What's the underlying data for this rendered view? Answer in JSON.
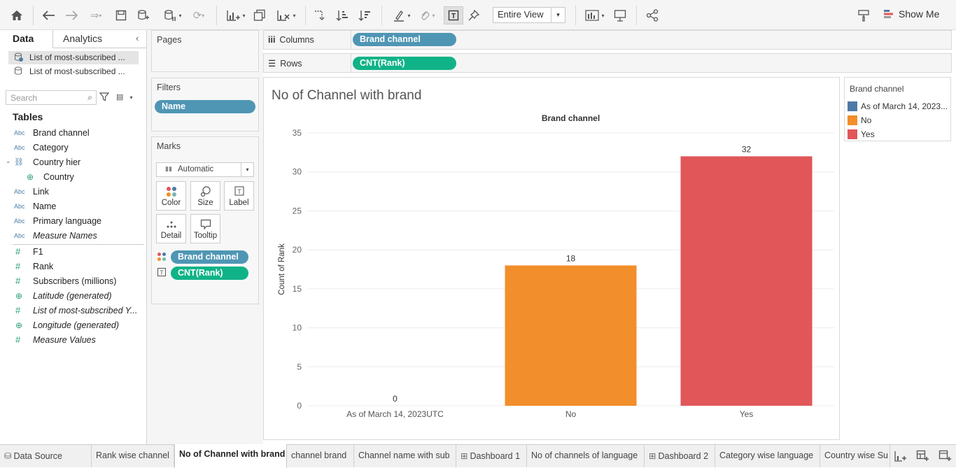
{
  "toolbar": {
    "view_select": "Entire View",
    "show_me": "Show Me"
  },
  "left": {
    "tab_data": "Data",
    "tab_analytics": "Analytics",
    "datasources": [
      "List of most-subscribed ...",
      "List of most-subscribed ..."
    ],
    "search_placeholder": "Search",
    "tables_label": "Tables",
    "dimensions": [
      "Brand channel",
      "Category",
      "Country hier",
      "Country",
      "Link",
      "Name",
      "Primary language",
      "Measure Names"
    ],
    "measures": [
      "F1",
      "Rank",
      "Subscribers (millions)",
      "Latitude (generated)",
      "List of most-subscribed Y...",
      "Longitude (generated)",
      "Measure Values"
    ]
  },
  "cards": {
    "pages": "Pages",
    "filters": "Filters",
    "filter_pill": "Name",
    "marks": "Marks",
    "marks_type": "Automatic",
    "btn_color": "Color",
    "btn_size": "Size",
    "btn_label": "Label",
    "btn_detail": "Detail",
    "btn_tooltip": "Tooltip",
    "marks_pill_color": "Brand channel",
    "marks_pill_label": "CNT(Rank)"
  },
  "shelves": {
    "columns_label": "Columns",
    "columns_pill": "Brand channel",
    "rows_label": "Rows",
    "rows_pill": "CNT(Rank)"
  },
  "viz": {
    "title": "No of Channel with brand"
  },
  "legend": {
    "title": "Brand channel",
    "items": [
      {
        "label": "As of March 14, 2023...",
        "color": "#4e79a7"
      },
      {
        "label": "No",
        "color": "#f28e2b"
      },
      {
        "label": "Yes",
        "color": "#e15759"
      }
    ]
  },
  "chart_data": {
    "type": "bar",
    "title": "Brand channel",
    "categories": [
      "As of March 14, 2023UTC",
      "No",
      "Yes"
    ],
    "values": [
      0,
      18,
      32
    ],
    "data_labels": [
      "0",
      "18",
      "32"
    ],
    "colors": [
      "#4e79a7",
      "#f28e2b",
      "#e15759"
    ],
    "xlabel": "",
    "ylabel": "Count of Rank",
    "ylim": [
      0,
      35
    ],
    "yticks": [
      0,
      5,
      10,
      15,
      20,
      25,
      30,
      35
    ],
    "grid": true
  },
  "sheets": {
    "data_source": "Data Source",
    "tabs": [
      "Rank wise channel",
      "No of Channel with brand",
      "channel brand",
      "Channel name with sub",
      "Dashboard 1",
      "No of channels of language",
      "Dashboard 2",
      "Category wise language",
      "Country wise Su"
    ]
  }
}
